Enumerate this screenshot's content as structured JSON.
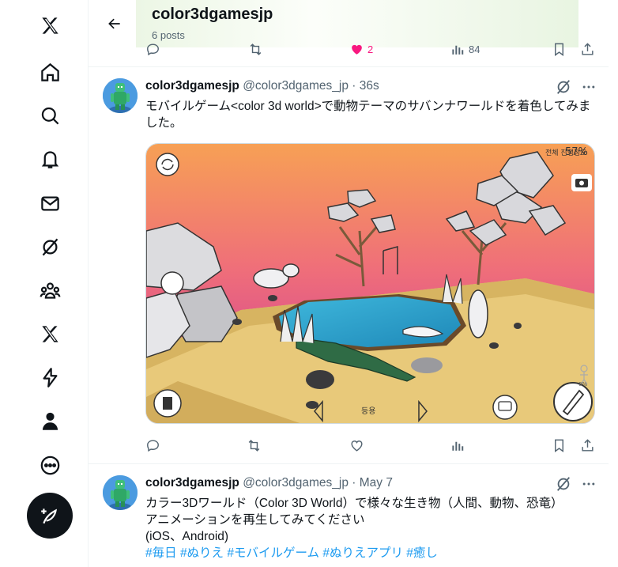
{
  "header": {
    "title": "color3dgamesjp",
    "subtitle": "6 posts"
  },
  "previous_post": {
    "likes": "2",
    "views": "84"
  },
  "posts": [
    {
      "display_name": "color3dgamesjp",
      "handle": "@color3dgames_jp",
      "separator": "·",
      "time": "36s",
      "text": "モバイルゲーム<color 3d world>で動物テーマのサバンナワールドを着色してみました。",
      "media": {
        "progress_label": "전체 진행정도",
        "progress_value": "57%",
        "page_indicator": "등용",
        "person_percent": "0%"
      }
    },
    {
      "display_name": "color3dgamesjp",
      "handle": "@color3dgames_jp",
      "separator": "·",
      "time": "May 7",
      "text_line1": "カラー3Dワールド（Color 3D World）で様々な生き物（人間、動物、恐竜）",
      "text_line2": "アニメーションを再生してみてください",
      "text_line3": "(iOS、Android)",
      "hashtags": [
        "#毎日",
        "#ぬりえ",
        "#モバイルゲーム",
        "#ぬりえアプリ",
        "#癒し"
      ]
    }
  ],
  "colors": {
    "accent": "#1d9bf0",
    "text": "#0f1419",
    "secondary": "#536471",
    "like": "#f91880"
  }
}
